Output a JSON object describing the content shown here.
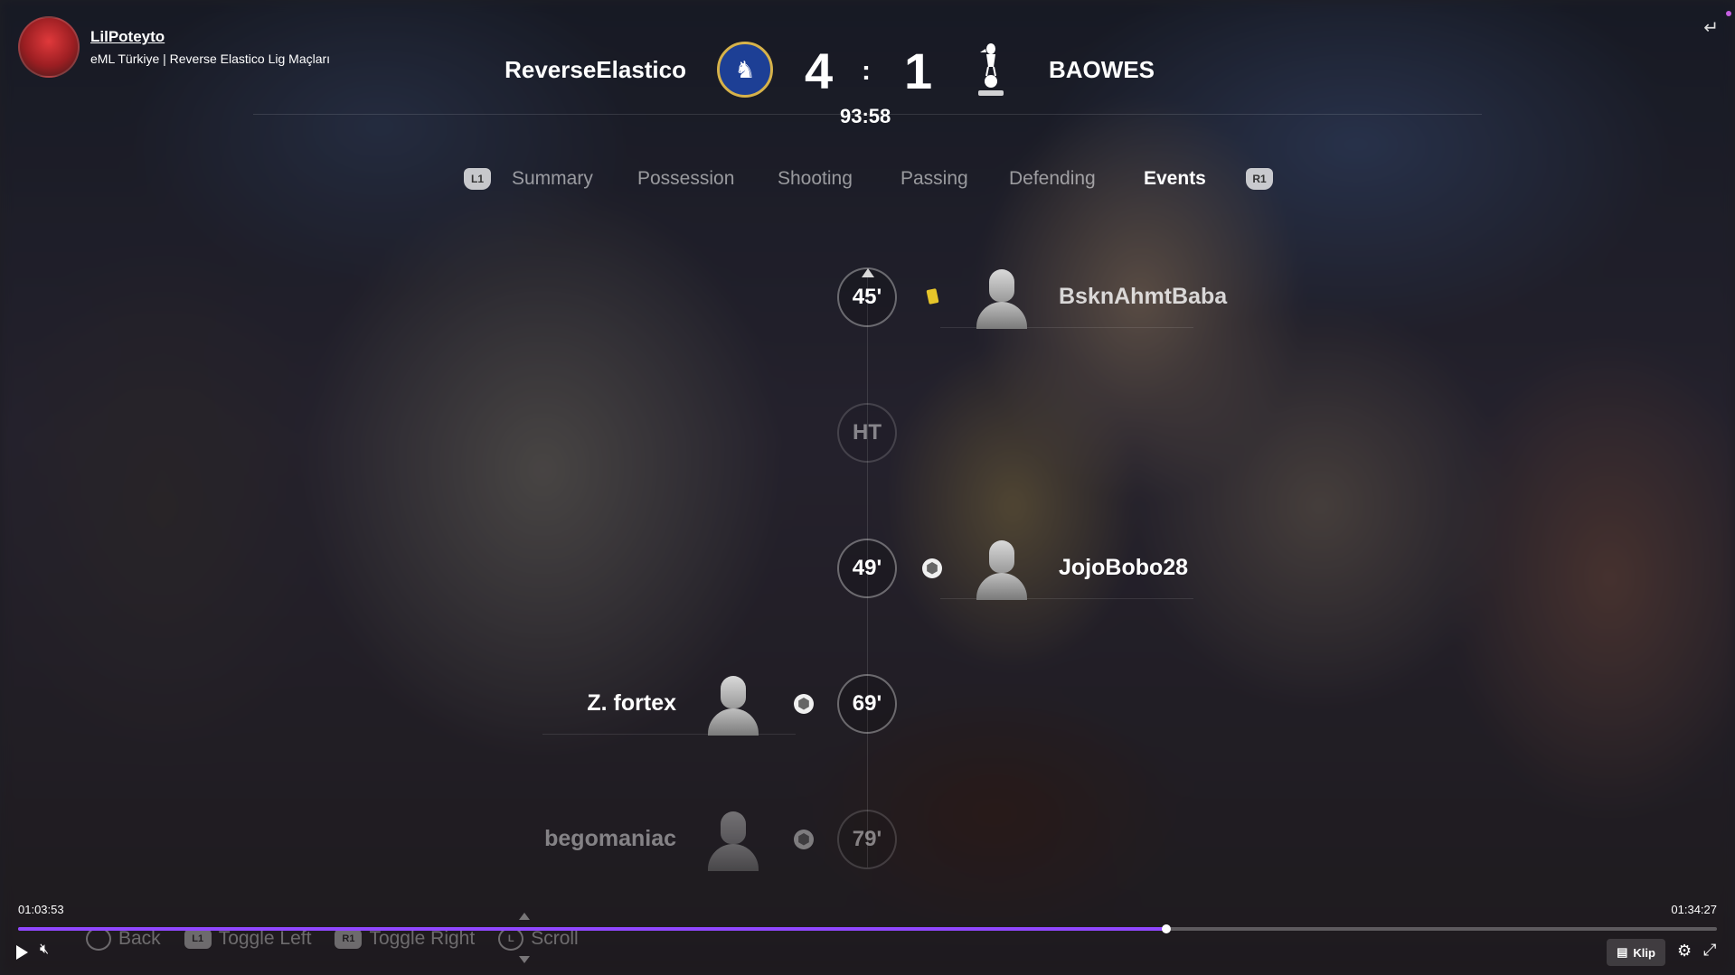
{
  "channel": {
    "name": "LilPoteyto",
    "stream_title": "eML Türkiye | Reverse Elastico Lig Maçları"
  },
  "scoreboard": {
    "home_team": "ReverseElastico",
    "away_team": "BAOWES",
    "home_score": "4",
    "separator": ":",
    "away_score": "1",
    "clock": "93:58",
    "home_crest": "chelsea-crest",
    "away_crest": "tottenham-crest"
  },
  "tabs": {
    "left_bumper": "L1",
    "right_bumper": "R1",
    "items": [
      {
        "label": "Summary"
      },
      {
        "label": "Possession"
      },
      {
        "label": "Shooting"
      },
      {
        "label": "Passing"
      },
      {
        "label": "Defending"
      },
      {
        "label": "Events",
        "active": true
      }
    ]
  },
  "events": [
    {
      "minute": "45'",
      "side": "away",
      "type": "yellow-card",
      "player": "BsknAhmtBaba"
    },
    {
      "minute": "HT",
      "side": "none",
      "type": "half-time",
      "player": ""
    },
    {
      "minute": "49'",
      "side": "away",
      "type": "goal",
      "player": "JojoBobo28"
    },
    {
      "minute": "69'",
      "side": "home",
      "type": "goal",
      "player": "Z. fortex"
    },
    {
      "minute": "79'",
      "side": "home",
      "type": "goal",
      "player": "begomaniac"
    }
  ],
  "hints": {
    "back": "Back",
    "toggle_left": "Toggle Left",
    "toggle_right": "Toggle Right",
    "scroll": "Scroll",
    "l1": "L1",
    "r1": "R1",
    "l": "L"
  },
  "player": {
    "current_time": "01:03:53",
    "total_time": "01:34:27",
    "progress_percent": 67.6,
    "clip_label": "Klip",
    "accent_color": "#9147ff"
  }
}
